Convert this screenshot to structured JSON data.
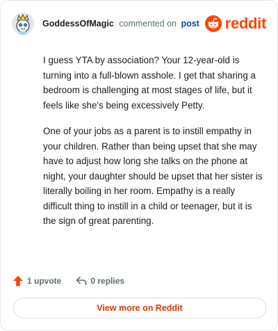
{
  "comment": {
    "username": "GoddessOfMagic",
    "action": "commented on",
    "post_link": "post",
    "paragraphs": [
      "I guess YTA by association? Your 12-year-old is turning into a full-blown asshole. I get that sharing a bedroom is challenging at most stages of life, but it feels like she's being excessively Petty.",
      "One of your jobs as a parent is to instill empathy in your children. Rather than being upset that she may have to adjust how long she talks on the phone at night, your daughter should be upset that her sister is literally boiling in her room. Empathy is a really difficult thing to instill in a child or teenager, but it is the sign of great parenting."
    ]
  },
  "brand": {
    "wordmark": "reddit",
    "color": "#ff4500"
  },
  "stats": {
    "upvotes": "1 upvote",
    "replies": "0 replies"
  },
  "footer": {
    "view_more": "View more on Reddit"
  },
  "icons": [
    "avatar",
    "reddit-logo-icon",
    "upvote-icon",
    "reply-icon"
  ]
}
